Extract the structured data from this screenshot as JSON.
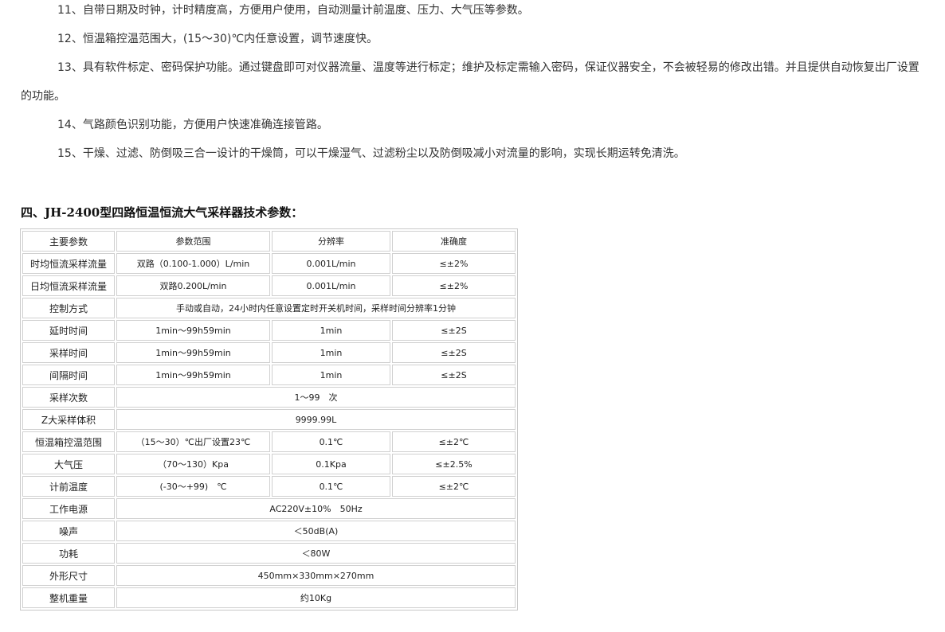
{
  "paragraphs": {
    "p11": "11、自带日期及时钟，计时精度高，方便用户使用，自动测量计前温度、压力、大气压等参数。",
    "p12": "12、恒温箱控温范围大，(15～30)℃内任意设置，调节速度快。",
    "p13": "13、具有软件标定、密码保护功能。通过键盘即可对仪器流量、温度等进行标定；维护及标定需输入密码，保证仪器安全，不会被轻易的修改出错。并且提供自动恢复出厂设置的功能。",
    "p14": "14、气路颜色识别功能，方便用户快速准确连接管路。",
    "p15": "15、干燥、过滤、防倒吸三合一设计的干燥筒，可以干燥湿气、过滤粉尘以及防倒吸减小对流量的影响，实现长期运转免清洗。"
  },
  "section_title": "四、JH-2400型四路恒温恒流大气采样器技术参数：",
  "table": {
    "header": [
      "主要参数",
      "参数范围",
      "分辨率",
      "准确度"
    ],
    "rows": [
      [
        "时均恒流采样流量",
        "双路（0.100-1.000）L/min",
        "0.001L/min",
        "≤±2%"
      ],
      [
        "日均恒流采样流量",
        "双路0.200L/min",
        "0.001L/min",
        "≤±2%"
      ],
      [
        "控制方式",
        "手动或自动，24小时内任意设置定时开关机时间，采样时间分辨率1分钟"
      ],
      [
        "延时时间",
        "1min～99h59min",
        "1min",
        "≤±2S"
      ],
      [
        "采样时间",
        "1min～99h59min",
        "1min",
        "≤±2S"
      ],
      [
        "间隔时间",
        "1min～99h59min",
        "1min",
        "≤±2S"
      ],
      [
        "采样次数",
        "1～99　次"
      ],
      [
        "Z大采样体积",
        "9999.99L"
      ],
      [
        "恒温箱控温范围",
        "（15～30）℃出厂设置23℃",
        "0.1℃",
        "≤±2℃"
      ],
      [
        "大气压",
        "（70～130）Kpa",
        "0.1Kpa",
        "≤±2.5%"
      ],
      [
        "计前温度",
        "(-30～+99)　℃",
        "0.1℃",
        "≤±2℃"
      ],
      [
        "工作电源",
        "AC220V±10%　50Hz"
      ],
      [
        "噪声",
        "＜50dB(A)"
      ],
      [
        "功耗",
        "＜80W"
      ],
      [
        "外形尺寸",
        "450mm×330mm×270mm"
      ],
      [
        "整机重量",
        "约10Kg"
      ]
    ]
  }
}
